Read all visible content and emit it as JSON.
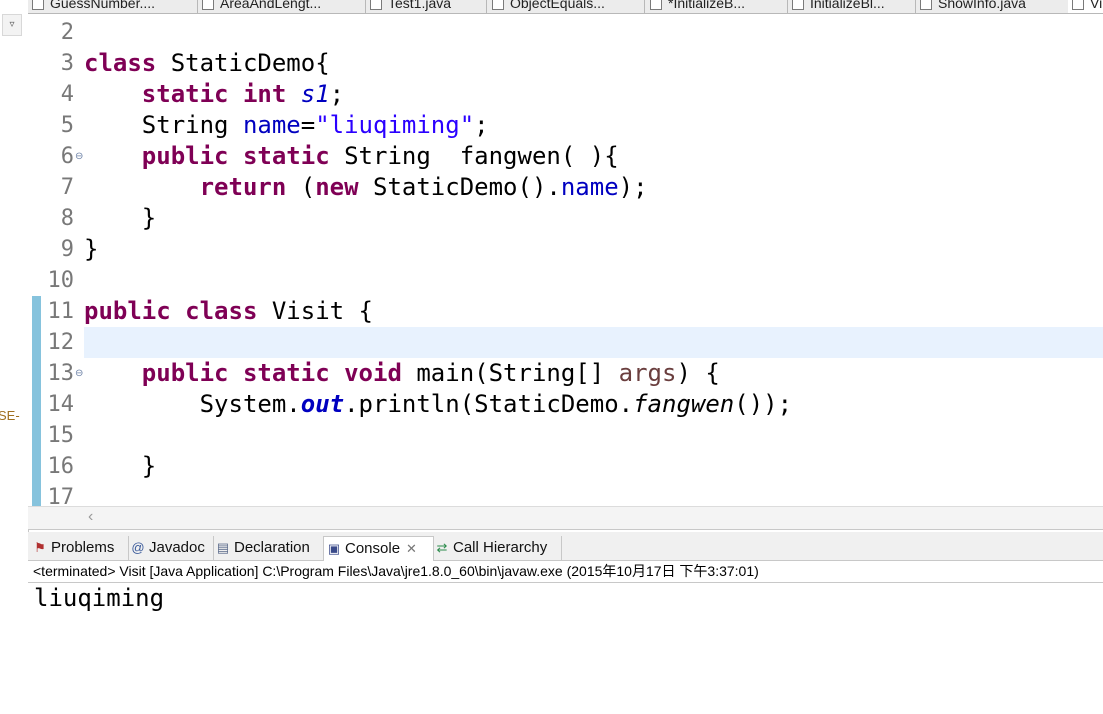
{
  "left_panel": {
    "collapse_glyph": "▿",
    "cut_label": "SE-"
  },
  "editor_tabs": [
    {
      "label": "GuessNumber...."
    },
    {
      "label": "AreaAndLengt..."
    },
    {
      "label": "Test1.java"
    },
    {
      "label": "ObjectEquals..."
    },
    {
      "label": "*InitializeB..."
    },
    {
      "label": "InitializeBl..."
    },
    {
      "label": "ShowInfo.java"
    },
    {
      "label": "Vi"
    }
  ],
  "code": {
    "line_numbers": [
      "2",
      "3",
      "4",
      "5",
      "6",
      "7",
      "8",
      "9",
      "10",
      "11",
      "12",
      "13",
      "14",
      "15",
      "16",
      "17"
    ],
    "fold_glyph": "⊖"
  },
  "views_tabs": [
    {
      "label": "Problems",
      "icon": "problems-icon",
      "glyph": "⚑"
    },
    {
      "label": "Javadoc",
      "icon": "javadoc-icon",
      "glyph": "@"
    },
    {
      "label": "Declaration",
      "icon": "declaration-icon",
      "glyph": "▤"
    },
    {
      "label": "Console",
      "icon": "console-icon",
      "glyph": "▣",
      "close": "✕"
    },
    {
      "label": "Call Hierarchy",
      "icon": "call-hierarchy-icon",
      "glyph": "⇄"
    }
  ],
  "console": {
    "status": "<terminated> Visit [Java Application] C:\\Program Files\\Java\\jre1.8.0_60\\bin\\javaw.exe (2015年10月17日 下午3:37:01)",
    "output": "liuqiming"
  },
  "scroll": {
    "left_arrow": "‹"
  }
}
